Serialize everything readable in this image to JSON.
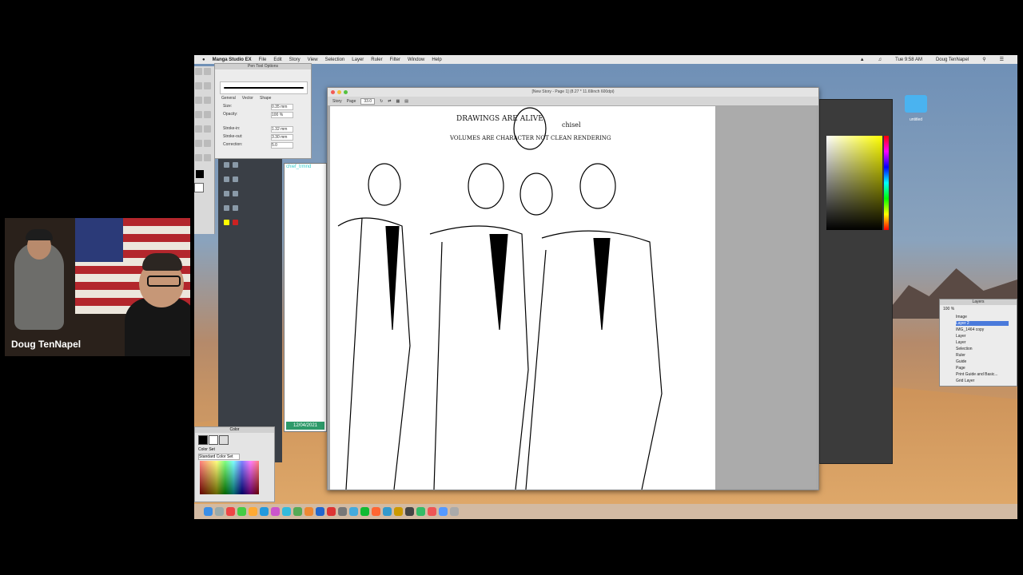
{
  "menubar": {
    "app_name": "Manga Studio EX",
    "items": [
      "File",
      "Edit",
      "Story",
      "View",
      "Selection",
      "Layer",
      "Ruler",
      "Filter",
      "Window",
      "Help"
    ],
    "clock": "Tue 9:58 AM",
    "user": "Doug TenNapel"
  },
  "pen_panel": {
    "title": "Pen Tool Options",
    "tabs": [
      "General",
      "Vector",
      "Shape"
    ],
    "rows": [
      {
        "label": "Size:",
        "value": "0.35 mm"
      },
      {
        "label": "Opacity:",
        "value": "100 %"
      },
      {
        "label": "Stroke-in:",
        "value": "1.32 mm"
      },
      {
        "label": "Stroke-out:",
        "value": "3.30 mm"
      },
      {
        "label": "Correction:",
        "value": "5.0"
      }
    ]
  },
  "mini_view": {
    "label": "chief_trmnd",
    "date": "12/04/2021"
  },
  "color_panel": {
    "title": "Color",
    "set_tab": "Color Set",
    "set_name": "Standard Color Set"
  },
  "main_window": {
    "title": "[New Story - Page 1] (8.27 * 11.69inch 600dpi)",
    "tabs": [
      "Story",
      "Page"
    ],
    "zoom": "33.0"
  },
  "sketch_notes": {
    "note1": "DRAWINGS ARE ALIVE",
    "note2": "VOLUMES ARE CHARACTER NOT CLEAN RENDERING",
    "note3": "chisel"
  },
  "layers_panel": {
    "title": "Layers",
    "zoom": "100 %",
    "items": [
      "Image",
      "Layer 2",
      "IMG_1464 copy",
      "Layer",
      "Layer",
      "Selection",
      "Ruler",
      "Guide",
      "Page",
      "Print Guide and Basic...",
      "Grid Layer"
    ]
  },
  "desktop": {
    "folder_label": "untitled"
  },
  "webcam": {
    "name": "Doug TenNapel"
  },
  "colors": {
    "menubar": "#e8e8e8",
    "accent_green": "#2e9a6a",
    "layer_select": "#4a7adb"
  }
}
